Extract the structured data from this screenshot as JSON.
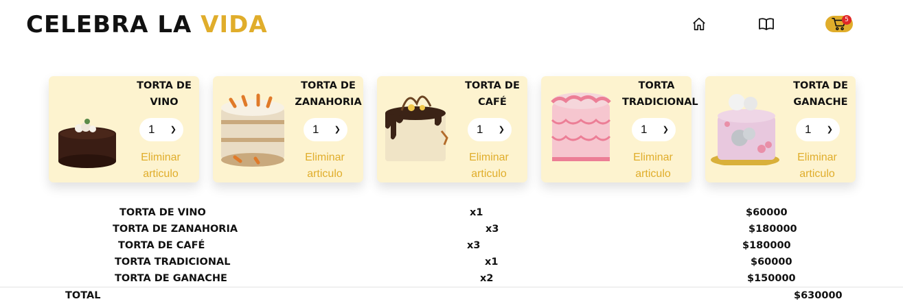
{
  "brand": {
    "part1": "CELEBRA LA",
    "part2": "VIDA"
  },
  "nav": {
    "home_icon": "home-icon",
    "menu_icon": "book-icon",
    "cart_icon": "cart-icon",
    "cart_count": "5"
  },
  "colors": {
    "accent": "#e0ad2b",
    "card_bg": "#fdf3cf",
    "badge": "#e02727"
  },
  "cards": [
    {
      "title": "TORTA DE VINO",
      "qty": "1",
      "remove_label": "Eliminar articulo"
    },
    {
      "title": "TORTA DE ZANAHORIA",
      "qty": "1",
      "remove_label": "Eliminar articulo"
    },
    {
      "title": "TORTA DE CAFÉ",
      "qty": "1",
      "remove_label": "Eliminar articulo"
    },
    {
      "title": "TORTA TRADICIONAL",
      "qty": "1",
      "remove_label": "Eliminar articulo"
    },
    {
      "title": "TORTA DE GANACHE",
      "qty": "1",
      "remove_label": "Eliminar articulo"
    }
  ],
  "summary": [
    {
      "name": "TORTA DE VINO",
      "qty": "x1",
      "price": "$60000"
    },
    {
      "name": "TORTA DE ZANAHORIA",
      "qty": "x3",
      "price": "$180000"
    },
    {
      "name": "TORTA DE CAFÉ",
      "qty": "x3",
      "price": "$180000"
    },
    {
      "name": "TORTA TRADICIONAL",
      "qty": "x1",
      "price": "$60000"
    },
    {
      "name": "TORTA DE GANACHE",
      "qty": "x2",
      "price": "$150000"
    }
  ],
  "total": {
    "label": "TOTAL",
    "value": "$630000"
  }
}
